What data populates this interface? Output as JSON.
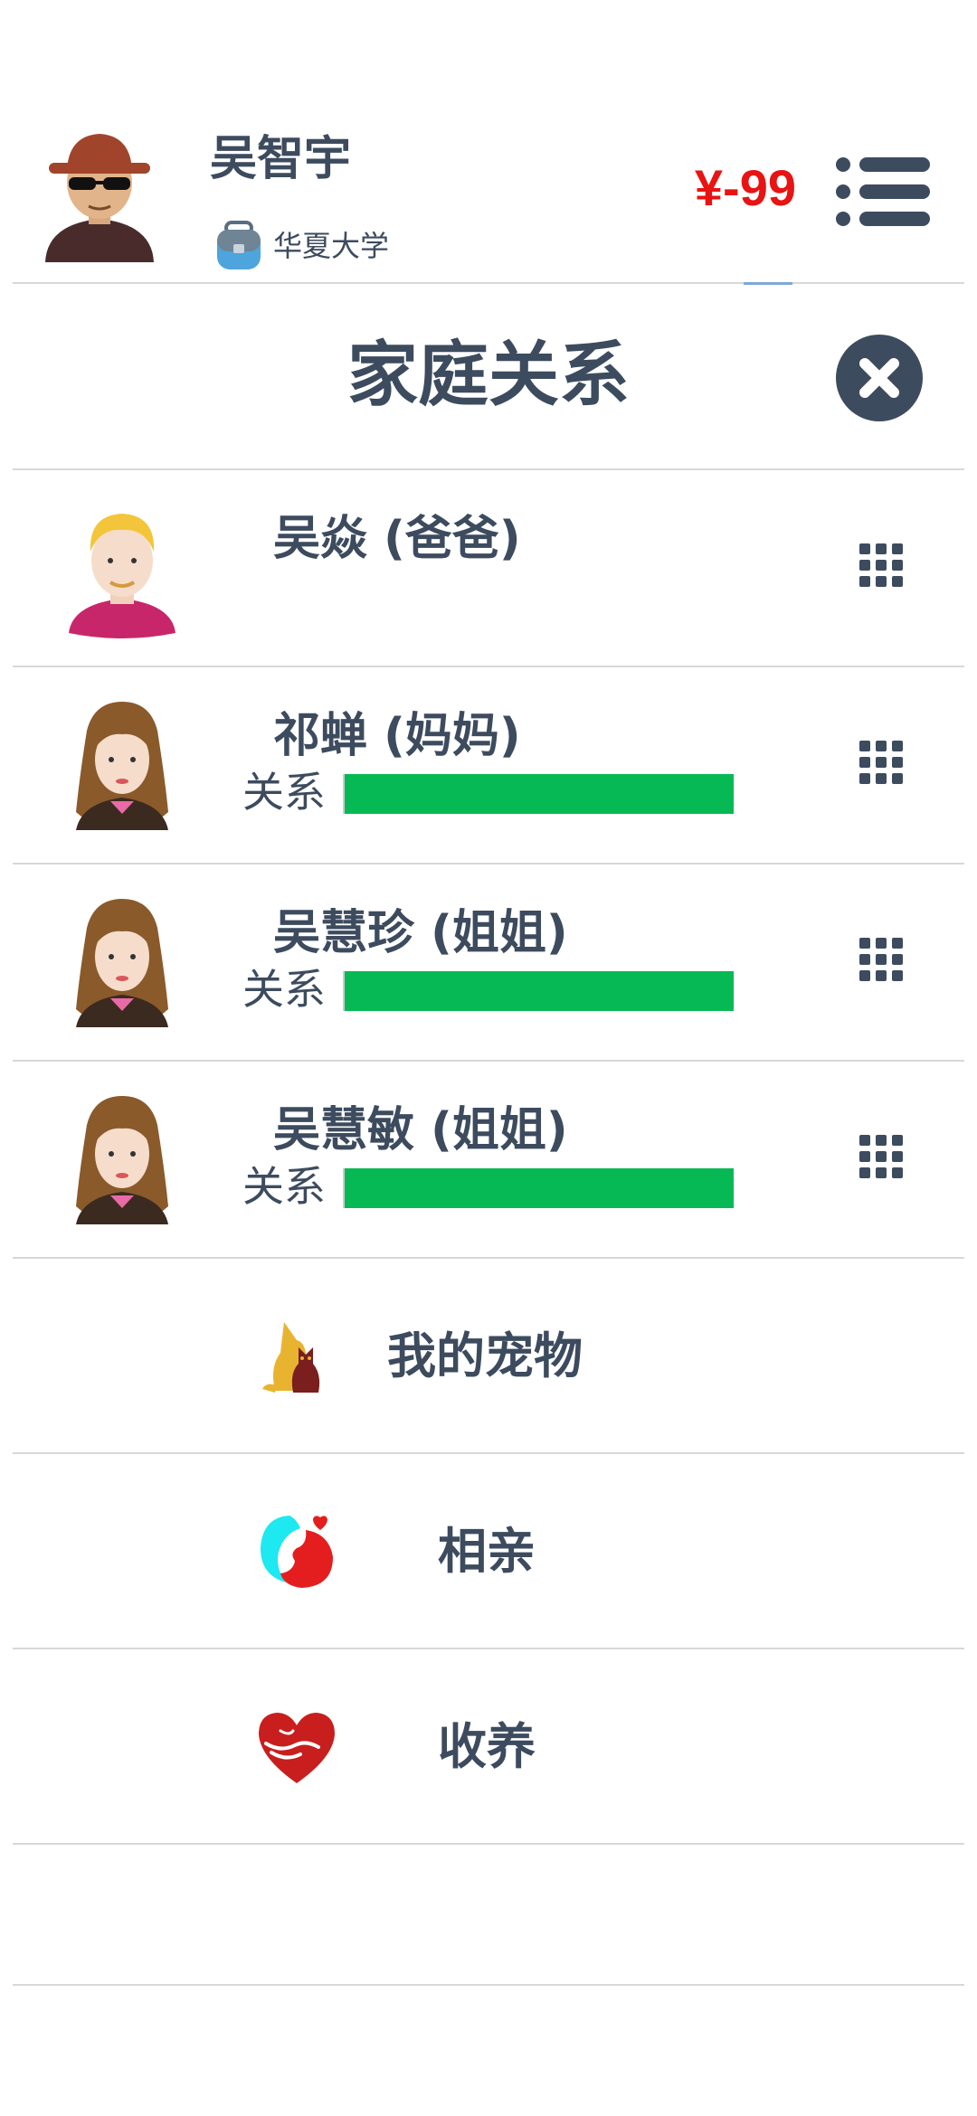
{
  "header": {
    "player_name": "吴智宇",
    "school": "华夏大学",
    "money": "¥-99"
  },
  "panel": {
    "title": "家庭关系"
  },
  "family": [
    {
      "name": "吴焱 (爸爸)",
      "relation_label": "",
      "relation_level": null,
      "avatar": "blond-man"
    },
    {
      "name": "祁蝉 (妈妈)",
      "relation_label": "关系",
      "relation_level": 1.0,
      "avatar": "brown-hair-woman"
    },
    {
      "name": "吴慧珍 (姐姐)",
      "relation_label": "关系",
      "relation_level": 1.0,
      "avatar": "brown-hair-woman"
    },
    {
      "name": "吴慧敏 (姐姐)",
      "relation_label": "关系",
      "relation_level": 1.0,
      "avatar": "brown-hair-woman"
    }
  ],
  "options": [
    {
      "label": "我的宠物",
      "icon": "pet-dog-cat-icon"
    },
    {
      "label": "相亲",
      "icon": "matchmaking-icon"
    },
    {
      "label": "收养",
      "icon": "adopt-heart-icon"
    }
  ],
  "colors": {
    "text": "#3d4b5e",
    "money": "#e81313",
    "relation_bar": "#07b954",
    "divider": "#d6d8db"
  }
}
